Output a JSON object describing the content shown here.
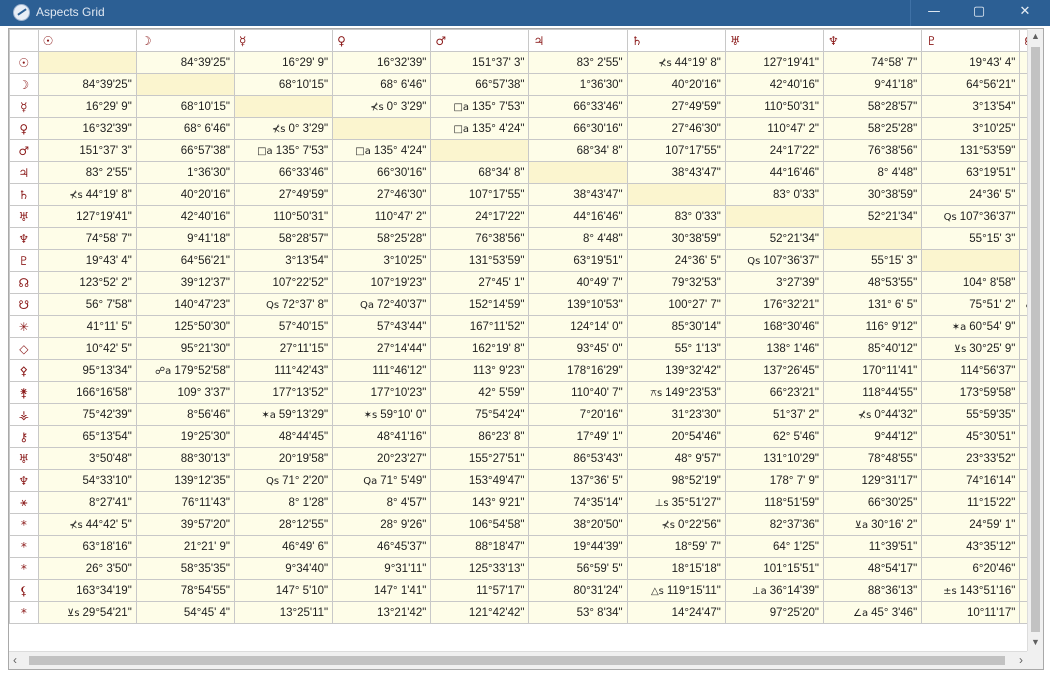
{
  "window": {
    "title": "Aspects Grid",
    "minimize": "—",
    "maximize": "▢",
    "close": "✕"
  },
  "columns": [
    "☉",
    "☽",
    "☿",
    "♀",
    "♂",
    "♃",
    "♄",
    "♅",
    "♆",
    "♇",
    "☊"
  ],
  "rows": [
    {
      "glyph": "☉",
      "cells": [
        null,
        "84°39'25\"",
        "16°29' 9\"",
        "16°32'39\"",
        "151°37' 3\"",
        "83° 2'55\"",
        {
          "sym": "⊀s",
          "color": "red",
          "value": "44°19' 8\""
        },
        "127°19'41\"",
        "74°58' 7\"",
        "19°43' 4\"",
        ""
      ]
    },
    {
      "glyph": "☽",
      "cells": [
        "84°39'25\"",
        null,
        "68°10'15\"",
        "68° 6'46\"",
        "66°57'38\"",
        "1°36'30\"",
        "40°20'16\"",
        "42°40'16\"",
        "9°41'18\"",
        "64°56'21\"",
        ""
      ]
    },
    {
      "glyph": "☿",
      "cells": [
        "16°29' 9\"",
        "68°10'15\"",
        null,
        {
          "sym": "⊀s",
          "color": "blue",
          "value": "0° 3'29\""
        },
        {
          "sym": "□a",
          "color": "green",
          "value": "135° 7'53\""
        },
        "66°33'46\"",
        "27°49'59\"",
        "110°50'31\"",
        "58°28'57\"",
        "3°13'54\"",
        ""
      ]
    },
    {
      "glyph": "♀",
      "cells": [
        "16°32'39\"",
        "68° 6'46\"",
        {
          "sym": "⊀s",
          "color": "blue",
          "value": "0° 3'29\""
        },
        null,
        {
          "sym": "□a",
          "color": "green",
          "value": "135° 4'24\""
        },
        "66°30'16\"",
        "27°46'30\"",
        "110°47' 2\"",
        "58°25'28\"",
        "3°10'25\"",
        ""
      ]
    },
    {
      "glyph": "♂",
      "cells": [
        "151°37' 3\"",
        "66°57'38\"",
        {
          "sym": "□a",
          "color": "green",
          "value": "135° 7'53\""
        },
        {
          "sym": "□a",
          "color": "green",
          "value": "135° 4'24\""
        },
        null,
        "68°34' 8\"",
        "107°17'55\"",
        "24°17'22\"",
        "76°38'56\"",
        "131°53'59\"",
        ""
      ]
    },
    {
      "glyph": "♃",
      "cells": [
        "83° 2'55\"",
        "1°36'30\"",
        "66°33'46\"",
        "66°30'16\"",
        "68°34' 8\"",
        null,
        "38°43'47\"",
        "44°16'46\"",
        "8° 4'48\"",
        "63°19'51\"",
        ""
      ]
    },
    {
      "glyph": "♄",
      "cells": [
        {
          "sym": "⊀s",
          "color": "red",
          "value": "44°19' 8\""
        },
        "40°20'16\"",
        "27°49'59\"",
        "27°46'30\"",
        "107°17'55\"",
        "38°43'47\"",
        null,
        "83° 0'33\"",
        "30°38'59\"",
        "24°36' 5\"",
        ""
      ]
    },
    {
      "glyph": "♅",
      "cells": [
        "127°19'41\"",
        "42°40'16\"",
        "110°50'31\"",
        "110°47' 2\"",
        "24°17'22\"",
        "44°16'46\"",
        "83° 0'33\"",
        null,
        "52°21'34\"",
        {
          "sym": "Qs",
          "color": "orange",
          "value": "107°36'37\""
        },
        ""
      ]
    },
    {
      "glyph": "♆",
      "cells": [
        "74°58' 7\"",
        "9°41'18\"",
        "58°28'57\"",
        "58°25'28\"",
        "76°38'56\"",
        "8° 4'48\"",
        "30°38'59\"",
        "52°21'34\"",
        null,
        "55°15' 3\"",
        ""
      ]
    },
    {
      "glyph": "♇",
      "cells": [
        "19°43' 4\"",
        "64°56'21\"",
        "3°13'54\"",
        "3°10'25\"",
        "131°53'59\"",
        "63°19'51\"",
        "24°36' 5\"",
        {
          "sym": "Qs",
          "color": "orange",
          "value": "107°36'37\""
        },
        "55°15' 3\"",
        null,
        ""
      ]
    },
    {
      "glyph": "☊",
      "cells": [
        "123°52' 2\"",
        "39°12'37\"",
        "107°22'52\"",
        "107°19'23\"",
        "27°45' 1\"",
        "40°49' 7\"",
        "79°32'53\"",
        "3°27'39\"",
        "48°53'55\"",
        "104° 8'58\"",
        ""
      ]
    },
    {
      "glyph": "☋",
      "cells": [
        "56° 7'58\"",
        "140°47'23\"",
        {
          "sym": "Qs",
          "color": "orange",
          "value": "72°37' 8\""
        },
        {
          "sym": "Qa",
          "color": "orange",
          "value": "72°40'37\""
        },
        "152°14'59\"",
        "139°10'53\"",
        "100°27' 7\"",
        "176°32'21\"",
        "131° 6' 5\"",
        "75°51' 2\"",
        {
          "sym": "☍s",
          "color": "",
          "value": ""
        }
      ]
    },
    {
      "glyph": "✳",
      "cells": [
        "41°11' 5\"",
        "125°50'30\"",
        "57°40'15\"",
        "57°43'44\"",
        "167°11'52\"",
        "124°14' 0\"",
        "85°30'14\"",
        "168°30'46\"",
        "116° 9'12\"",
        {
          "sym": "✶a",
          "color": "blue",
          "value": "60°54' 9\""
        },
        {
          "sym": "Qa",
          "color": "red",
          "value": ""
        }
      ]
    },
    {
      "glyph": "◇",
      "cells": [
        "10°42' 5\"",
        "95°21'30\"",
        "27°11'15\"",
        "27°14'44\"",
        "162°19' 8\"",
        "93°45' 0\"",
        "55° 1'13\"",
        "138° 1'46\"",
        "85°40'12\"",
        {
          "sym": "⊻s",
          "color": "green",
          "value": "30°25' 9\""
        },
        {
          "sym": "□s",
          "color": "green",
          "value": ""
        }
      ]
    },
    {
      "glyph": "⚴",
      "cells": [
        "95°13'34\"",
        {
          "sym": "☍a",
          "color": "",
          "value": "179°52'58\""
        },
        "111°42'43\"",
        "111°46'12\"",
        "113° 9'23\"",
        "178°16'29\"",
        "139°32'42\"",
        "137°26'45\"",
        "170°11'41\"",
        "114°56'37\"",
        ""
      ]
    },
    {
      "glyph": "⚵",
      "cells": [
        "166°16'58\"",
        "109° 3'37\"",
        "177°13'52\"",
        "177°10'23\"",
        "42° 5'59\"",
        "110°40' 7\"",
        {
          "sym": "⚻s",
          "color": "green",
          "value": "149°23'53\""
        },
        "66°23'21\"",
        "118°44'55\"",
        "173°59'58\"",
        ""
      ]
    },
    {
      "glyph": "⚶",
      "cells": [
        "75°42'39\"",
        "8°56'46\"",
        {
          "sym": "✶a",
          "color": "blue",
          "value": "59°13'29\""
        },
        {
          "sym": "✶s",
          "color": "blue",
          "value": "59°10' 0\""
        },
        "75°54'24\"",
        "7°20'16\"",
        "31°23'30\"",
        "51°37' 2\"",
        {
          "sym": "⊀s",
          "color": "blue",
          "value": "0°44'32\""
        },
        "55°59'35\"",
        ""
      ]
    },
    {
      "glyph": "⚷",
      "cells": [
        "65°13'54\"",
        "19°25'30\"",
        "48°44'45\"",
        "48°41'16\"",
        "86°23' 8\"",
        "17°49' 1\"",
        "20°54'46\"",
        "62° 5'46\"",
        "9°44'12\"",
        "45°30'51\"",
        ""
      ]
    },
    {
      "glyph": "♅",
      "cells": [
        "3°50'48\"",
        "88°30'13\"",
        "20°19'58\"",
        "20°23'27\"",
        "155°27'51\"",
        "86°53'43\"",
        "48° 9'57\"",
        "131°10'29\"",
        "78°48'55\"",
        "23°33'52\"",
        ""
      ]
    },
    {
      "glyph": "♆",
      "cells": [
        "54°33'10\"",
        "139°12'35\"",
        {
          "sym": "Qs",
          "color": "orange",
          "value": "71° 2'20\""
        },
        {
          "sym": "Qa",
          "color": "orange",
          "value": "71° 5'49\""
        },
        "153°49'47\"",
        "137°36' 5\"",
        "98°52'19\"",
        "178° 7' 9\"",
        "129°31'17\"",
        "74°16'14\"",
        ""
      ]
    },
    {
      "glyph": "⚹",
      "cells": [
        "8°27'41\"",
        "76°11'43\"",
        "8° 1'28\"",
        "8° 4'57\"",
        "143° 9'21\"",
        "74°35'14\"",
        {
          "sym": "⊥s",
          "color": "orange",
          "value": "35°51'27\""
        },
        "118°51'59\"",
        "66°30'25\"",
        "11°15'22\"",
        ""
      ]
    },
    {
      "glyph": "*",
      "cells": [
        {
          "sym": "⊀s",
          "color": "red",
          "value": "44°42' 5\""
        },
        "39°57'20\"",
        "28°12'55\"",
        "28° 9'26\"",
        "106°54'58\"",
        "38°20'50\"",
        {
          "sym": "⊀s",
          "color": "blue",
          "value": "0°22'56\""
        },
        "82°37'36\"",
        {
          "sym": "⊻a",
          "color": "green",
          "value": "30°16' 2\""
        },
        "24°59' 1\"",
        ""
      ]
    },
    {
      "glyph": "*",
      "cells": [
        "63°18'16\"",
        "21°21' 9\"",
        "46°49' 6\"",
        "46°45'37\"",
        "88°18'47\"",
        "19°44'39\"",
        "18°59' 7\"",
        "64° 1'25\"",
        "11°39'51\"",
        "43°35'12\"",
        {
          "sym": "✶a",
          "color": "blue",
          "value": ""
        }
      ]
    },
    {
      "glyph": "*",
      "cells": [
        "26° 3'50\"",
        "58°35'35\"",
        "9°34'40\"",
        "9°31'11\"",
        "125°33'13\"",
        "56°59' 5\"",
        "18°15'18\"",
        "101°15'51\"",
        "48°54'17\"",
        "6°20'46\"",
        ""
      ]
    },
    {
      "glyph": "⚸",
      "cells": [
        "163°34'19\"",
        "78°54'55\"",
        "147° 5'10\"",
        "147° 1'41\"",
        "11°57'17\"",
        "80°31'24\"",
        {
          "sym": "△s",
          "color": "blue",
          "value": "119°15'11\""
        },
        {
          "sym": "⊥a",
          "color": "orange",
          "value": "36°14'39\""
        },
        "88°36'13\"",
        {
          "sym": "±s",
          "color": "orange",
          "value": "143°51'16\""
        },
        ""
      ]
    },
    {
      "glyph": "*",
      "cells": [
        {
          "sym": "⊻s",
          "color": "green",
          "value": "29°54'21\""
        },
        "54°45' 4\"",
        "13°25'11\"",
        "13°21'42\"",
        "121°42'42\"",
        "53° 8'34\"",
        "14°24'47\"",
        "97°25'20\"",
        {
          "sym": "∠a",
          "color": "red",
          "value": "45° 3'46\""
        },
        "10°11'17\"",
        ""
      ]
    }
  ]
}
